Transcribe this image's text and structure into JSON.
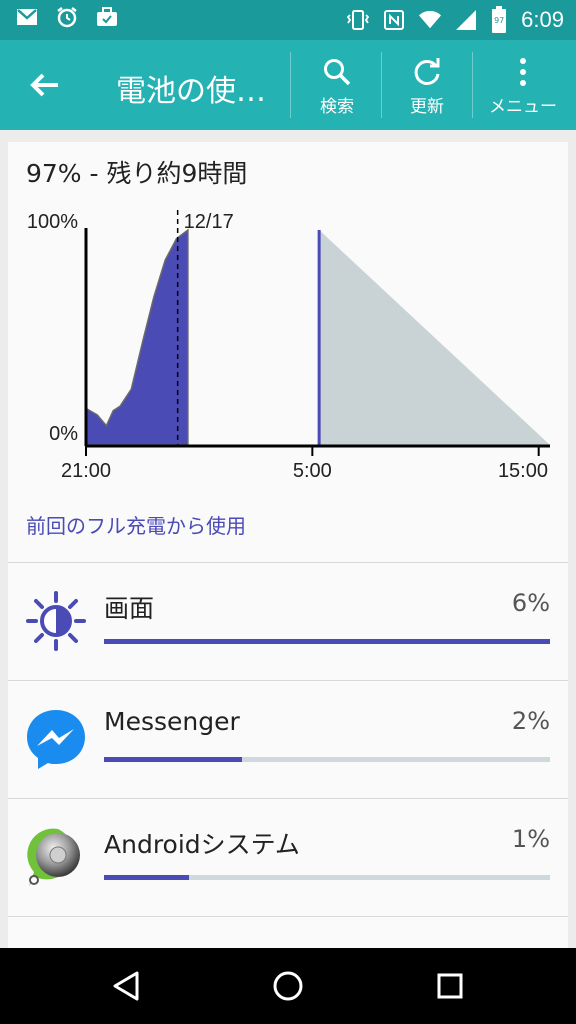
{
  "status_bar": {
    "time": "6:09",
    "battery_level": "97",
    "left_icons": [
      "gmail-icon",
      "alarm-icon",
      "briefcase-icon"
    ],
    "right_icons": [
      "vibrate-icon",
      "nfc-icon",
      "wifi-icon",
      "signal-icon",
      "battery-icon"
    ]
  },
  "app_bar": {
    "title": "電池の使…",
    "actions": [
      {
        "label": "検索",
        "icon": "search-icon"
      },
      {
        "label": "更新",
        "icon": "refresh-icon"
      },
      {
        "label": "メニュー",
        "icon": "more-vert-icon"
      }
    ]
  },
  "summary": "97% - 残り約9時間",
  "chart_data": {
    "type": "area",
    "y_tick_labels": [
      "100%",
      "0%"
    ],
    "ylim": [
      0,
      100
    ],
    "x_tick_labels": [
      "21:00",
      "5:00",
      "15:00"
    ],
    "date_marker": "12/17",
    "series": [
      {
        "values": [
          {
            "t": 0.0,
            "y": 17
          },
          {
            "t": 0.5,
            "y": 14
          },
          {
            "t": 0.9,
            "y": 9
          },
          {
            "t": 1.2,
            "y": 16
          },
          {
            "t": 1.5,
            "y": 18
          },
          {
            "t": 2.0,
            "y": 26
          },
          {
            "t": 2.5,
            "y": 48
          },
          {
            "t": 3.0,
            "y": 69
          },
          {
            "t": 3.5,
            "y": 86
          },
          {
            "t": 4.0,
            "y": 96
          },
          {
            "t": 4.5,
            "y": 100
          }
        ],
        "color": "#4b4bb5"
      },
      {
        "values": [
          {
            "t": 10.3,
            "y": 100
          },
          {
            "t": 20.5,
            "y": 0
          }
        ],
        "color": "#c9d3d6"
      }
    ],
    "colors": {
      "used": "#4b4bb5",
      "projected": "#c9d3d6",
      "axis": "#000000"
    }
  },
  "section_title": "前回のフル充電から使用",
  "apps": [
    {
      "name": "画面",
      "percent_label": "6%",
      "bar_fraction": 1.0,
      "icon": "brightness-icon"
    },
    {
      "name": "Messenger",
      "percent_label": "2%",
      "bar_fraction": 0.31,
      "icon": "messenger-icon"
    },
    {
      "name": "Androidシステム",
      "percent_label": "1%",
      "bar_fraction": 0.19,
      "icon": "android-system-icon"
    }
  ],
  "colors": {
    "status_bar": "#1a9a9a",
    "app_bar": "#24b2b2",
    "accent": "#4b4bb5",
    "track": "#cfd8dc"
  },
  "nav_bar": {
    "buttons": [
      "back-nav-icon",
      "home-nav-icon",
      "recents-nav-icon"
    ]
  }
}
